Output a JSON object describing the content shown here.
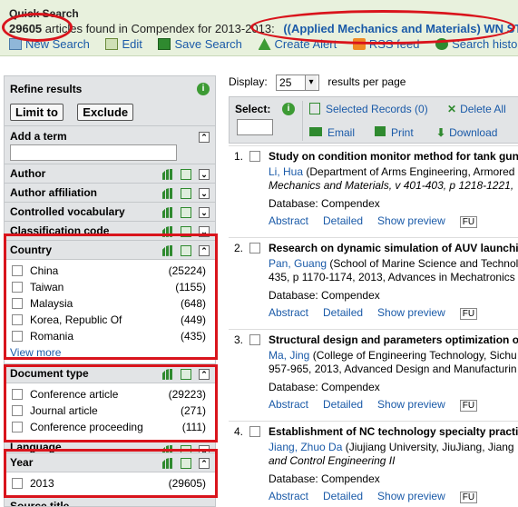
{
  "quick_search": {
    "title": "Quick Search",
    "count": "29605",
    "summary": "articles found in Compendex for 2013-2013:",
    "query": "((Applied Mechanics and Materials) WN ST)",
    "actions": [
      {
        "label": "New Search",
        "icon": "new-search-icon"
      },
      {
        "label": "Edit",
        "icon": "edit-icon"
      },
      {
        "label": "Save Search",
        "icon": "save-icon"
      },
      {
        "label": "Create Alert",
        "icon": "alert-icon"
      },
      {
        "label": "RSS feed",
        "icon": "rss-icon"
      },
      {
        "label": "Search history",
        "icon": "history-icon"
      }
    ]
  },
  "refine": {
    "title": "Refine results",
    "limit_label": "Limit to",
    "exclude_label": "Exclude",
    "add_term_label": "Add a term",
    "add_term_value": "",
    "facets": [
      "Author",
      "Author affiliation",
      "Controlled vocabulary",
      "Classification code"
    ],
    "country": {
      "title": "Country",
      "items": [
        {
          "name": "China",
          "count": "(25224)"
        },
        {
          "name": "Taiwan",
          "count": "(1155)"
        },
        {
          "name": "Malaysia",
          "count": "(648)"
        },
        {
          "name": "Korea, Republic Of",
          "count": "(449)"
        },
        {
          "name": "Romania",
          "count": "(435)"
        }
      ],
      "view_more": "View more"
    },
    "doctype": {
      "title": "Document type",
      "items": [
        {
          "name": "Conference article",
          "count": "(29223)"
        },
        {
          "name": "Journal article",
          "count": "(271)"
        },
        {
          "name": "Conference proceeding",
          "count": "(111)"
        }
      ]
    },
    "language_title": "Language",
    "year": {
      "title": "Year",
      "items": [
        {
          "name": "2013",
          "count": "(29605)"
        }
      ]
    },
    "source_title": "Source title"
  },
  "results": {
    "display_label": "Display:",
    "display_value": "25",
    "per_page_label": "results per page",
    "select_label": "Select:",
    "selected_records": "Selected Records (0)",
    "delete_all": "Delete All",
    "email": "Email",
    "print": "Print",
    "download": "Download",
    "records": [
      {
        "num": "1.",
        "title": "Study on condition monitor method for tank gun r",
        "author": "Li, Hua",
        "affil": " (Department of Arms Engineering, Armored",
        "source": "Mechanics and Materials, v 401-403, p 1218-1221,",
        "db": "Database: Compendex"
      },
      {
        "num": "2.",
        "title": "Research on dynamic simulation of AUV launchin",
        "author": "Pan, Guang",
        "affil": " (School of Marine Science and Technol",
        "source": "435, p 1170-1174, 2013, Advances in Mechatronics",
        "db": "Database: Compendex"
      },
      {
        "num": "3.",
        "title": "Structural design and parameters optimization of",
        "author": "Ma, Jing",
        "affil": " (College of Engineering Technology, Sichu",
        "source": "957-965, 2013, Advanced Design and Manufacturin",
        "db": "Database: Compendex"
      },
      {
        "num": "4.",
        "title": "Establishment of NC technology specialty practic",
        "author": "Jiang, Zhuo Da",
        "affil": " (Jiujiang University, JiuJiang, Jiang",
        "source": "and Control Engineering II",
        "db": "Database: Compendex"
      }
    ],
    "abstract": "Abstract",
    "detailed": "Detailed",
    "show_preview": "Show preview",
    "full_text": "FU"
  }
}
